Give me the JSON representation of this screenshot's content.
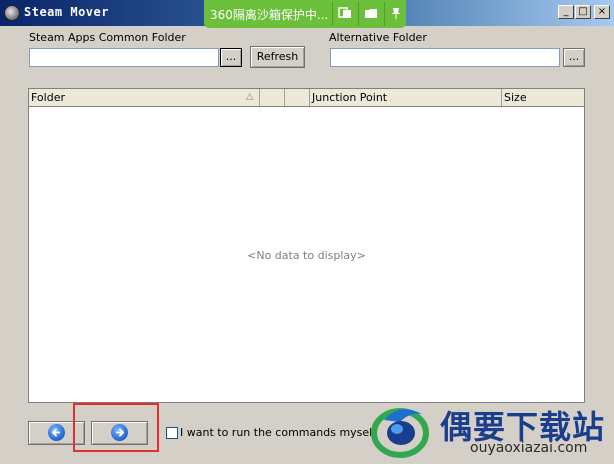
{
  "window": {
    "title": "Steam Mover",
    "controls": {
      "minimize": "_",
      "maximize": "□",
      "close": "×"
    }
  },
  "sandbox_overlay": {
    "text": "360隔离沙箱保护中..."
  },
  "steam_folder": {
    "label": "Steam Apps Common Folder",
    "value": "",
    "browse_label": "...",
    "refresh_label": "Refresh"
  },
  "alt_folder": {
    "label": "Alternative Folder",
    "value": "",
    "browse_label": "..."
  },
  "grid": {
    "columns": [
      "Folder",
      "",
      "",
      "Junction Point",
      "Size"
    ],
    "sort_indicator": "△",
    "empty_text": "<No data to display>"
  },
  "footer": {
    "back_icon": "arrow-left-circle",
    "next_icon": "arrow-right-circle",
    "checkbox_label": "I want to run the commands myself",
    "checkbox_checked": false
  },
  "watermark": {
    "text": "偶要下载站",
    "url": "ouyaoxiazai.com"
  },
  "colors": {
    "window_bg": "#d4d0c8",
    "sandbox_green": "#6cbf3b",
    "highlight_red": "#e03030",
    "watermark_blue": "#1a3e8c"
  }
}
